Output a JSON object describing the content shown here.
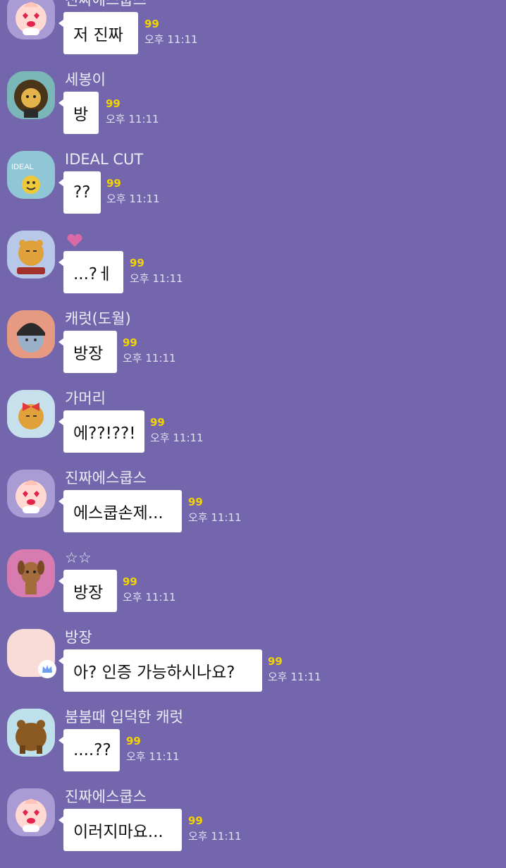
{
  "messages": [
    {
      "sender": "진짜에스쿱스",
      "text": "저 진짜",
      "unread": "99",
      "time": "오후 11:11",
      "avatar": "peach-heart-eyes-avatar"
    },
    {
      "sender": "세봉이",
      "text": "방",
      "unread": "99",
      "time": "오후 11:11",
      "avatar": "lion-mane-avatar"
    },
    {
      "sender": "IDEAL CUT",
      "text": "??",
      "unread": "99",
      "time": "오후 11:11",
      "avatar": "ideal-cut-avatar",
      "avatar_text": "IDEAL"
    },
    {
      "sender": "",
      "sender_icon": "heart-icon",
      "text": "...?ㅔ",
      "unread": "99",
      "time": "오후 11:11",
      "avatar": "ryan-drummer-avatar"
    },
    {
      "sender": "캐럿(도월)",
      "text": "방장",
      "unread": "99",
      "time": "오후 11:11",
      "avatar": "bowl-cut-character-avatar"
    },
    {
      "sender": "가머리",
      "text": "에??!??!",
      "unread": "99",
      "time": "오후 11:11",
      "avatar": "ryan-bow-avatar"
    },
    {
      "sender": "진짜에스쿱스",
      "text": "에스쿱손제...",
      "unread": "99",
      "time": "오후 11:11",
      "avatar": "peach-heart-eyes-avatar"
    },
    {
      "sender": "☆☆",
      "text": "방장",
      "unread": "99",
      "time": "오후 11:11",
      "avatar": "frodo-dog-avatar"
    },
    {
      "sender": "방장",
      "text": "아? 인증 가능하시나요?",
      "unread": "99",
      "time": "오후 11:11",
      "avatar": "blank-avatar",
      "badge": "crown-icon"
    },
    {
      "sender": "붐붐때 입덕한 캐럿",
      "text": "....??",
      "unread": "99",
      "time": "오후 11:11",
      "avatar": "bear-back-avatar"
    },
    {
      "sender": "진짜에스쿱스",
      "text": "이러지마요...",
      "unread": "99",
      "time": "오후 11:11",
      "avatar": "peach-heart-eyes-avatar"
    }
  ],
  "colors": {
    "background": "#7466ad",
    "bubble": "#ffffff",
    "unread": "#f2d400",
    "heart": "#d96aa7"
  }
}
